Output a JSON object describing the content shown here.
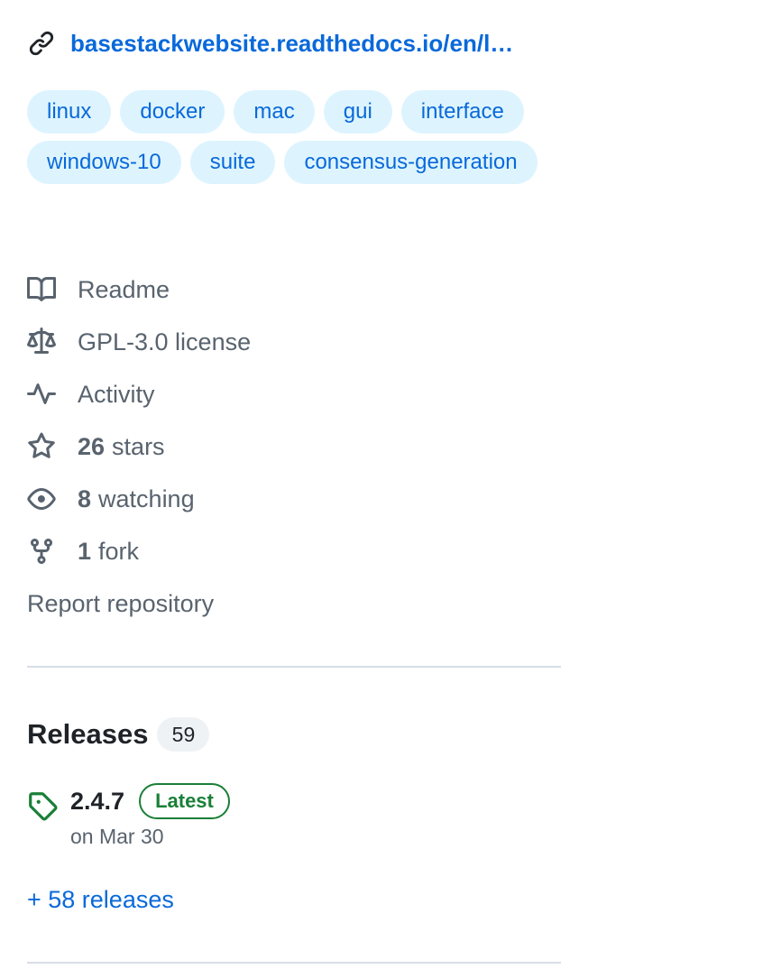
{
  "homepage": {
    "url_text": "basestackwebsite.readthedocs.io/en/l…",
    "icon": "link-icon"
  },
  "topics": [
    "linux",
    "docker",
    "mac",
    "gui",
    "interface",
    "windows-10",
    "suite",
    "consensus-generation"
  ],
  "meta": {
    "readme": {
      "label": "Readme",
      "icon": "book-icon"
    },
    "license": {
      "label": "GPL-3.0 license",
      "icon": "law-icon"
    },
    "activity": {
      "label": "Activity",
      "icon": "pulse-icon"
    },
    "stars": {
      "count": "26",
      "label": "stars",
      "icon": "star-icon"
    },
    "watching": {
      "count": "8",
      "label": "watching",
      "icon": "eye-icon"
    },
    "forks": {
      "count": "1",
      "label": "fork",
      "icon": "repo-forked-icon"
    },
    "report": "Report repository"
  },
  "releases": {
    "title": "Releases",
    "count": "59",
    "latest": {
      "version": "2.4.7",
      "badge": "Latest",
      "date": "on Mar 30",
      "icon": "tag-icon"
    },
    "more_link": "+ 58 releases"
  },
  "colors": {
    "link": "#0969da",
    "topic_bg": "#ddf4ff",
    "muted": "#59636e",
    "success": "#1a7f37",
    "divider": "#d8dee4"
  }
}
